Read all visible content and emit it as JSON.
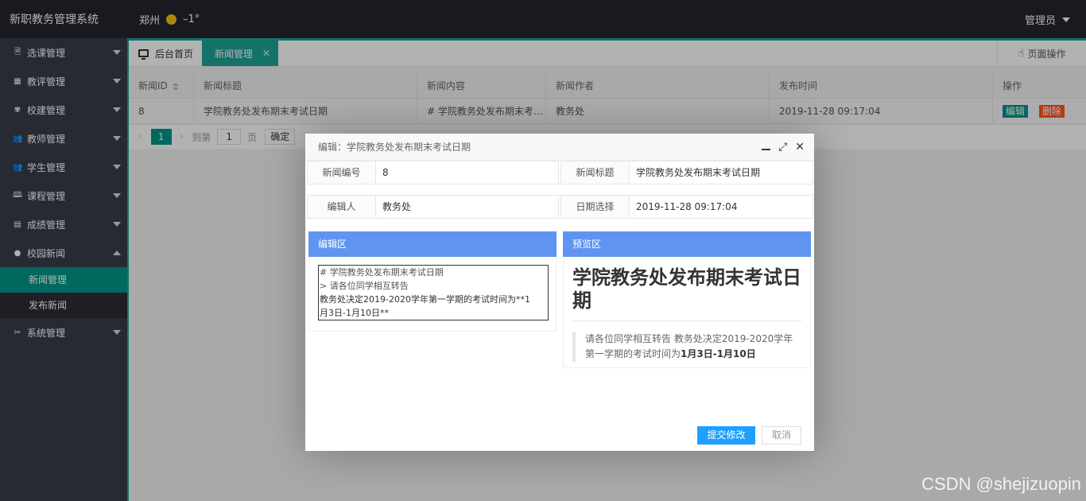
{
  "header": {
    "logo": "新职教务管理系统",
    "city": "郑州",
    "temperature": "–1°",
    "user": "管理员"
  },
  "sidebar": {
    "items": [
      {
        "label": "选课管理",
        "icon": "document-icon"
      },
      {
        "label": "教评管理",
        "icon": "grid-icon"
      },
      {
        "label": "校建管理",
        "icon": "building-icon"
      },
      {
        "label": "教师管理",
        "icon": "users-icon"
      },
      {
        "label": "学生管理",
        "icon": "users-icon"
      },
      {
        "label": "课程管理",
        "icon": "book-icon"
      },
      {
        "label": "成绩管理",
        "icon": "report-icon"
      },
      {
        "label": "校园新闻",
        "icon": "chat-icon"
      },
      {
        "label": "系统管理",
        "icon": "tools-icon"
      }
    ],
    "sub_items": [
      {
        "label": "新闻管理",
        "active": true
      },
      {
        "label": "发布新闻",
        "active": false
      }
    ]
  },
  "tabs": {
    "home": "后台首页",
    "news": "新闻管理",
    "page_op": "页面操作"
  },
  "table": {
    "headers": [
      "新闻ID",
      "新闻标题",
      "新闻内容",
      "新闻作者",
      "发布时间",
      "操作"
    ],
    "rows": [
      {
        "id": "8",
        "title": "学院教务处发布期末考试日期",
        "content": "# 学院教务处发布期末考试日期 > 请各位同学相互转告",
        "author": "教务处",
        "time": "2019-11-28 09:17:04",
        "edit": "编辑",
        "delete": "删除"
      }
    ]
  },
  "pager": {
    "current": "1",
    "goto_label": "到第",
    "page_input": "1",
    "page_unit": "页",
    "confirm": "确定"
  },
  "dialog": {
    "title": "编辑：学院教务处发布期末考试日期",
    "fields": {
      "id_label": "新闻编号",
      "id_value": "8",
      "title_label": "新闻标题",
      "title_value": "学院教务处发布期末考试日期",
      "editor_label": "编辑人",
      "editor_value": "教务处",
      "date_label": "日期选择",
      "date_value": "2019-11-28 09:17:04"
    },
    "edit_panel": "编辑区",
    "preview_panel": "预览区",
    "editor_lines": [
      "# 学院教务处发布期末考试日期",
      "> 请各位同学相互转告",
      "教务处决定2019-2020学年第一学期的考试时间为**1",
      "月3日-1月10日**"
    ],
    "preview_title": "学院教务处发布期末考试日期",
    "preview_quote_text": "请各位同学相互转告 教务处决定2019-2020学年第一学期的考试时间为",
    "preview_quote_bold": "1月3日-1月10日",
    "submit": "提交修改",
    "cancel": "取消"
  },
  "watermark": "CSDN @shejizuopin",
  "colors": {
    "topbar": "#23262e",
    "sidebar": "#393d49",
    "accent": "#009688",
    "panel_head": "#5f95f0",
    "submit": "#1e9fff",
    "delete": "#ff5722"
  }
}
